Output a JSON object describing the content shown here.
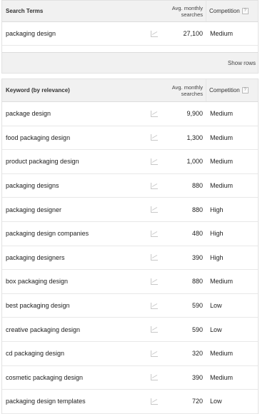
{
  "search_terms_table": {
    "header": {
      "term": "Search Terms",
      "searches_line1": "Avg. monthly",
      "searches_line2": "searches",
      "competition": "Competition",
      "help": "?"
    },
    "rows": [
      {
        "term": "packaging design",
        "searches": "27,100",
        "competition": "Medium"
      }
    ],
    "show_rows": "Show rows"
  },
  "keyword_table": {
    "header": {
      "keyword": "Keyword (by relevance)",
      "searches_line1": "Avg. monthly",
      "searches_line2": "searches",
      "competition": "Competition",
      "help": "?"
    },
    "rows": [
      {
        "keyword": "package design",
        "searches": "9,900",
        "competition": "Medium"
      },
      {
        "keyword": "food packaging design",
        "searches": "1,300",
        "competition": "Medium"
      },
      {
        "keyword": "product packaging design",
        "searches": "1,000",
        "competition": "Medium"
      },
      {
        "keyword": "packaging designs",
        "searches": "880",
        "competition": "Medium"
      },
      {
        "keyword": "packaging designer",
        "searches": "880",
        "competition": "High"
      },
      {
        "keyword": "packaging design companies",
        "searches": "480",
        "competition": "High"
      },
      {
        "keyword": "packaging designers",
        "searches": "390",
        "competition": "High"
      },
      {
        "keyword": "box packaging design",
        "searches": "880",
        "competition": "Medium"
      },
      {
        "keyword": "best packaging design",
        "searches": "590",
        "competition": "Low"
      },
      {
        "keyword": "creative packaging design",
        "searches": "590",
        "competition": "Low"
      },
      {
        "keyword": "cd packaging design",
        "searches": "320",
        "competition": "Medium"
      },
      {
        "keyword": "cosmetic packaging design",
        "searches": "390",
        "competition": "Medium"
      },
      {
        "keyword": "packaging design templates",
        "searches": "720",
        "competition": "Low"
      }
    ]
  },
  "icons": {
    "trend": "trend-chart-icon",
    "help": "help-icon"
  }
}
